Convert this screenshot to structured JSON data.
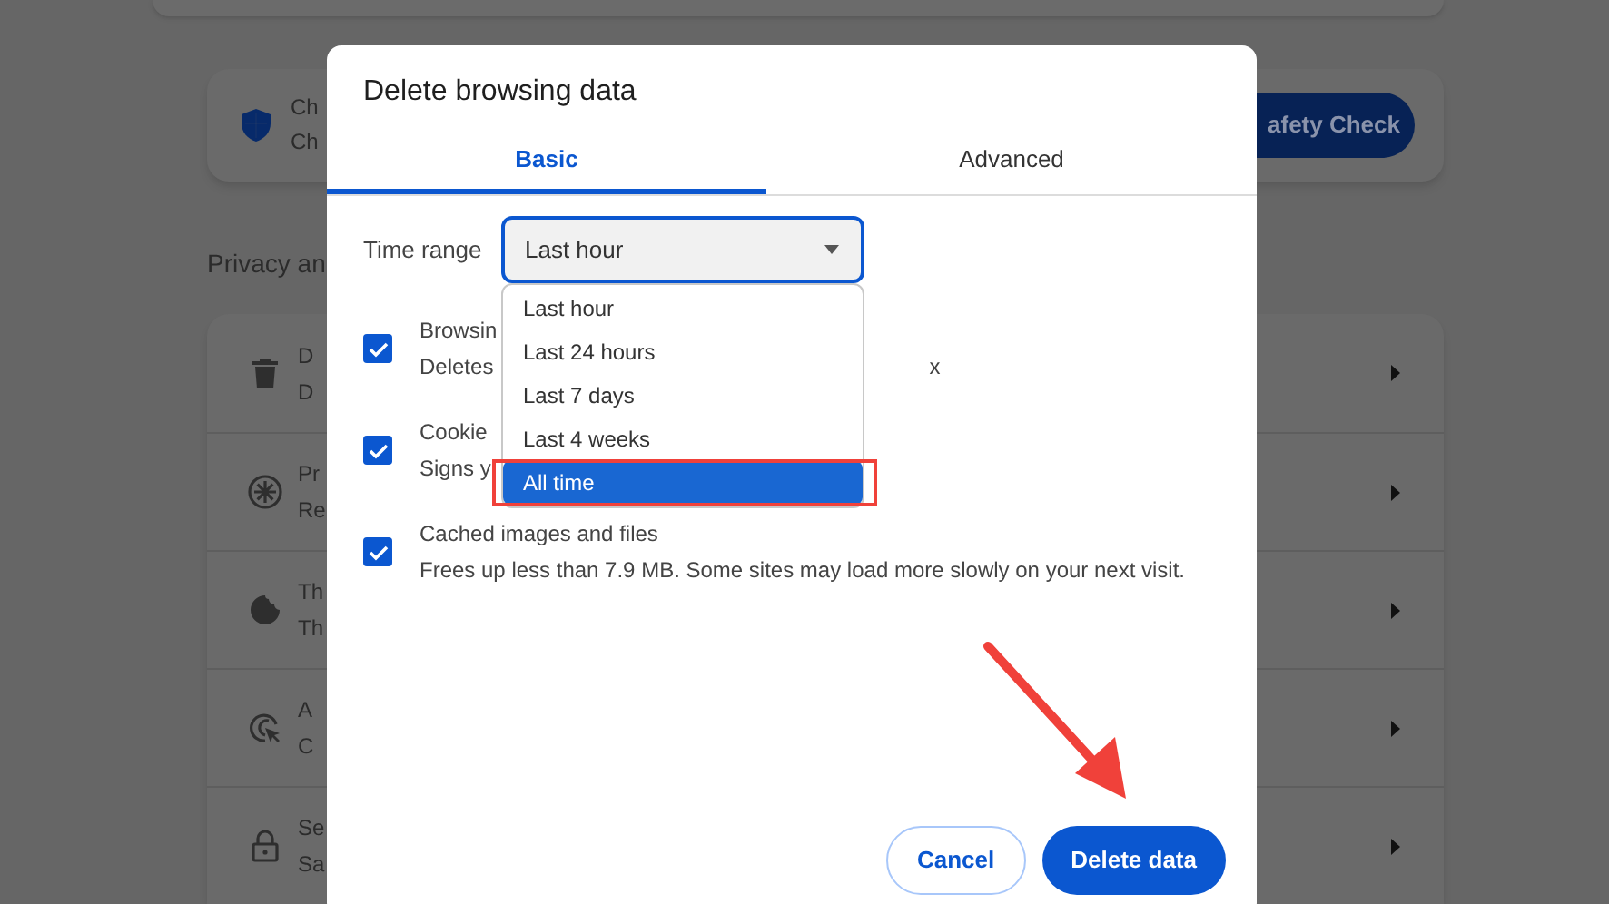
{
  "background": {
    "safety_card": {
      "title": "Ch",
      "subtitle": "Ch",
      "button": "afety Check"
    },
    "section_heading": "Privacy an",
    "rows": [
      {
        "title": "D",
        "subtitle": "D"
      },
      {
        "title": "Pr",
        "subtitle": "Re"
      },
      {
        "title": "Th",
        "subtitle": "Th"
      },
      {
        "title": "A",
        "subtitle": "C"
      },
      {
        "title": "Se",
        "subtitle": "Sa"
      }
    ]
  },
  "dialog": {
    "title": "Delete browsing data",
    "tabs": [
      {
        "label": "Basic",
        "selected": true
      },
      {
        "label": "Advanced",
        "selected": false
      }
    ],
    "time_range": {
      "label": "Time range",
      "value": "Last hour",
      "expanded": true
    },
    "options": [
      {
        "label": "Last hour",
        "selected": false
      },
      {
        "label": "Last 24 hours",
        "selected": false
      },
      {
        "label": "Last 7 days",
        "selected": false
      },
      {
        "label": "Last 4 weeks",
        "selected": false
      },
      {
        "label": "All time",
        "selected": true
      }
    ],
    "items": [
      {
        "title": "Browsin",
        "description": "Deletes",
        "description_tail": "x",
        "checked": true
      },
      {
        "title": "Cookie",
        "description": "Signs y",
        "checked": true
      },
      {
        "title": "Cached images and files",
        "description": "Frees up less than 7.9 MB. Some sites may load more slowly on your next visit.",
        "checked": true
      }
    ],
    "buttons": {
      "cancel": "Cancel",
      "confirm": "Delete data"
    }
  }
}
